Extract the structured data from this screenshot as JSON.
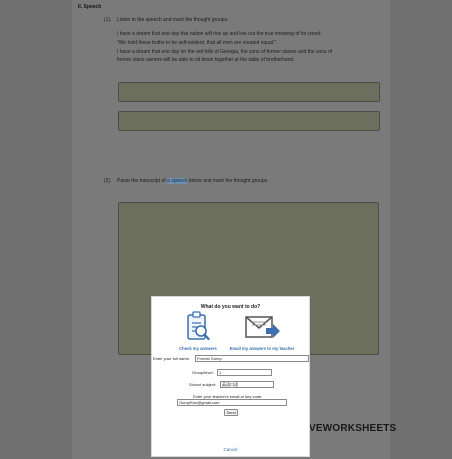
{
  "worksheet": {
    "section_title": "II. Speech",
    "q1_number": "(1).",
    "q1_text": "Listen to the speech and mark the thought groups.",
    "paragraph_lines": [
      "I have a dream that one day this nation will rise up and live out the true meaning of its creed:",
      "\"We hold these truths to be self-evident, that all men are created equal.\"",
      "I have a dream that one day on the red hills of Georgia, the sons of former slaves and the sons of",
      "former slave owners will be able to sit down together at the table of brotherhood."
    ],
    "q2_number": "(2).",
    "q2_text_before": "Paste the transcript of",
    "q2_highlight": "a speech",
    "q2_text_after": "below and mark the thought groups.",
    "brand_text": "VEWORKSHEETS"
  },
  "dialog": {
    "title": "What do you want to do?",
    "check_label": "Check my answers",
    "email_label": "Email my answers to my teacher",
    "name_label": "Enter your full name:",
    "name_value": "Forrest Gump",
    "group_label": "Group/level:",
    "group_value": "1",
    "subject_label": "School subject:",
    "subject_value": "英语口语",
    "teacher_label": "Enter your teacher's email or key code:",
    "teacher_value": "GumpRun@gmail.com",
    "send_label": "Send",
    "cancel_label": "Cancel"
  },
  "colors": {
    "accent": "#3a6fb0",
    "answer_box": "#6c6f5e"
  }
}
